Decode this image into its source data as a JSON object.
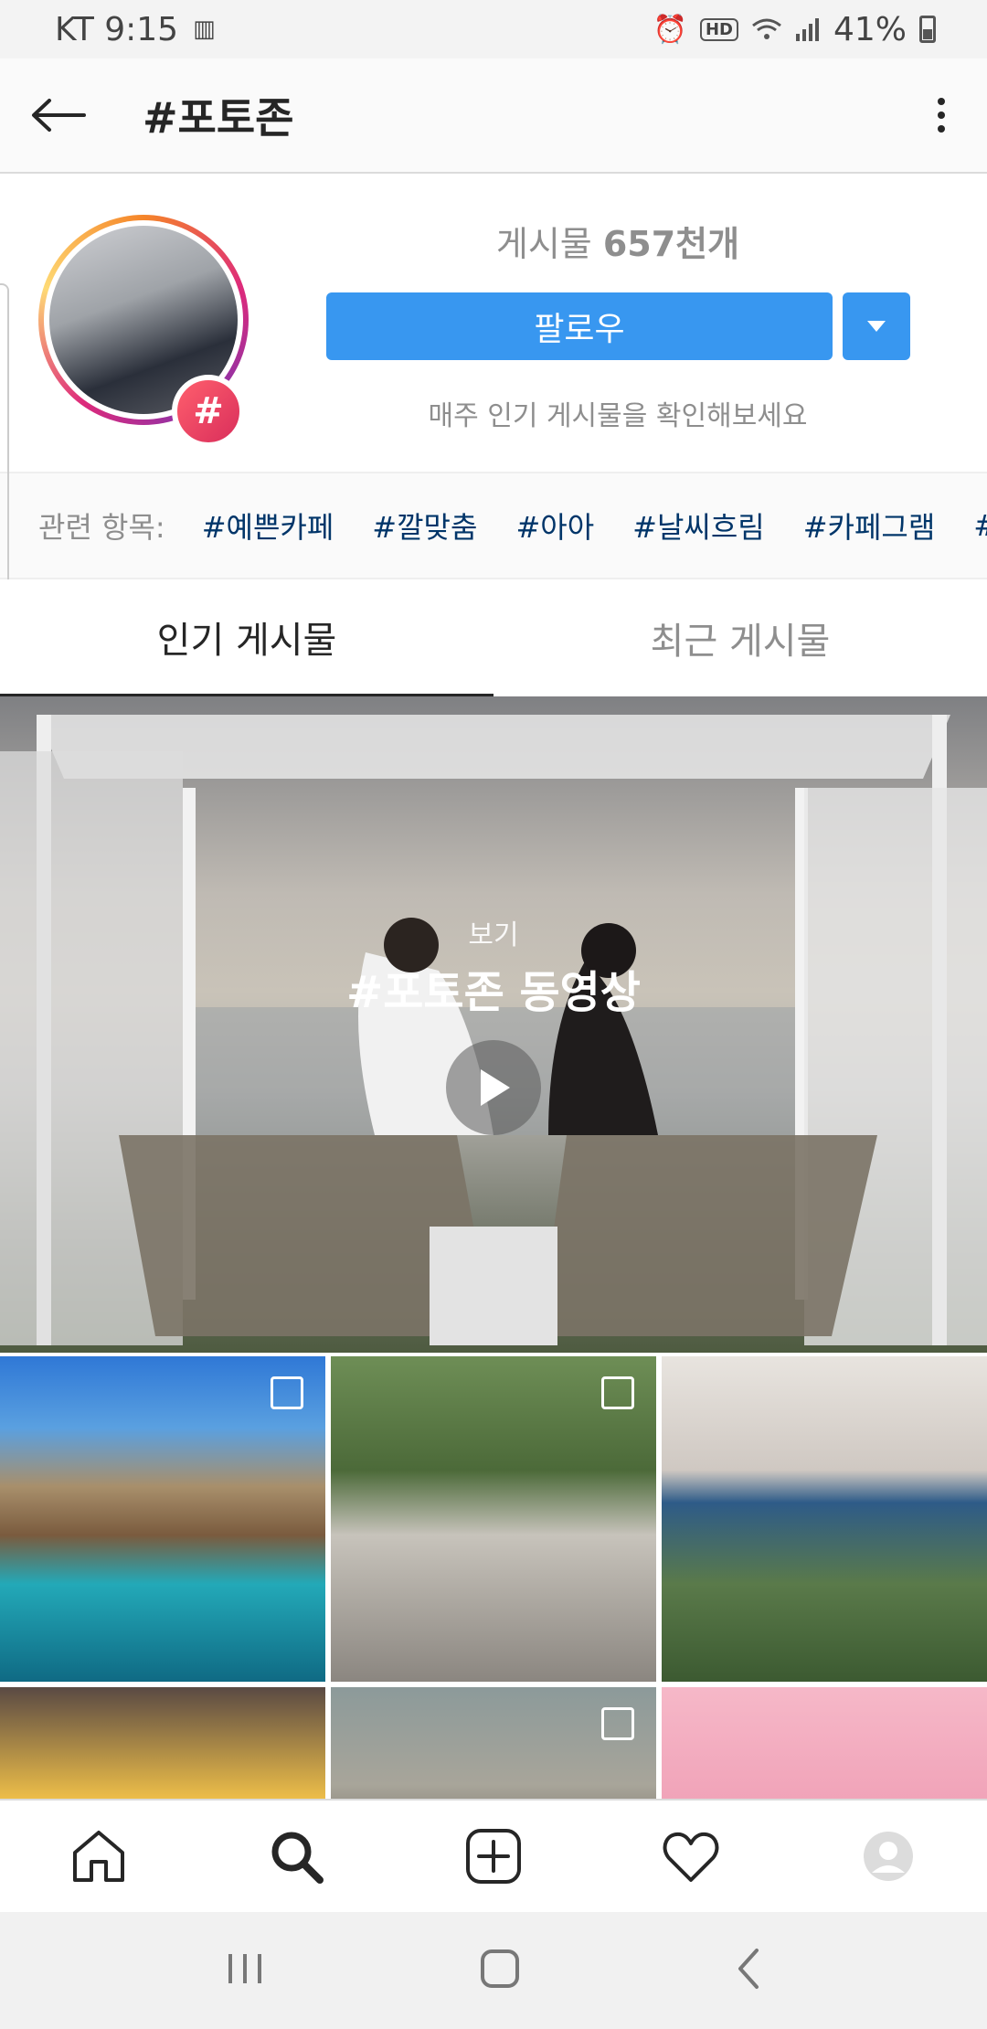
{
  "status_bar": {
    "carrier_time": "KT 9:15",
    "hd": "HD",
    "battery_pct": "41%"
  },
  "header": {
    "title": "#포토존"
  },
  "profile": {
    "post_count_prefix": "게시물 ",
    "post_count_value": "657천개",
    "follow_label": "팔로우",
    "weekly_note": "매주 인기 게시물을 확인해보세요",
    "hashtag_badge": "#"
  },
  "related": {
    "label": "관련 항목:",
    "tags": [
      "#예쁜카페",
      "#깔맞춤",
      "#아아",
      "#날씨흐림",
      "#카페그램",
      "#"
    ]
  },
  "tabs": [
    {
      "label": "인기 게시물",
      "active": true
    },
    {
      "label": "최근 게시물",
      "active": false
    }
  ],
  "video": {
    "sub": "보기",
    "title": "#포토존 동영상"
  },
  "grid": [
    {
      "icon": "multi-photo-icon"
    },
    {
      "icon": "multi-photo-icon"
    },
    {
      "icon": "none"
    },
    {
      "icon": "none"
    },
    {
      "icon": "multi-photo-icon"
    },
    {
      "icon": "none"
    }
  ],
  "bottom_nav": [
    "home-icon",
    "search-icon",
    "add-post-icon",
    "heart-icon",
    "profile-icon"
  ],
  "colors": {
    "accent": "#3897f0",
    "tag_link": "#003569",
    "muted": "#8e8e8e"
  }
}
